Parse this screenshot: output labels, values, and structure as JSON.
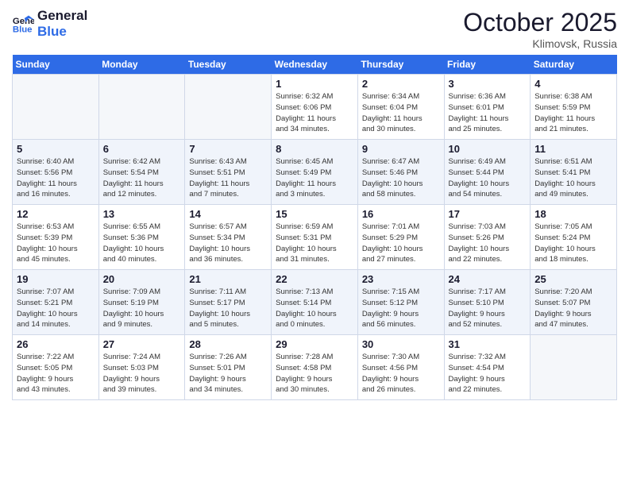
{
  "logo": {
    "line1": "General",
    "line2": "Blue"
  },
  "title": "October 2025",
  "location": "Klimovsk, Russia",
  "weekdays": [
    "Sunday",
    "Monday",
    "Tuesday",
    "Wednesday",
    "Thursday",
    "Friday",
    "Saturday"
  ],
  "weeks": [
    [
      {
        "day": "",
        "info": ""
      },
      {
        "day": "",
        "info": ""
      },
      {
        "day": "",
        "info": ""
      },
      {
        "day": "1",
        "info": "Sunrise: 6:32 AM\nSunset: 6:06 PM\nDaylight: 11 hours\nand 34 minutes."
      },
      {
        "day": "2",
        "info": "Sunrise: 6:34 AM\nSunset: 6:04 PM\nDaylight: 11 hours\nand 30 minutes."
      },
      {
        "day": "3",
        "info": "Sunrise: 6:36 AM\nSunset: 6:01 PM\nDaylight: 11 hours\nand 25 minutes."
      },
      {
        "day": "4",
        "info": "Sunrise: 6:38 AM\nSunset: 5:59 PM\nDaylight: 11 hours\nand 21 minutes."
      }
    ],
    [
      {
        "day": "5",
        "info": "Sunrise: 6:40 AM\nSunset: 5:56 PM\nDaylight: 11 hours\nand 16 minutes."
      },
      {
        "day": "6",
        "info": "Sunrise: 6:42 AM\nSunset: 5:54 PM\nDaylight: 11 hours\nand 12 minutes."
      },
      {
        "day": "7",
        "info": "Sunrise: 6:43 AM\nSunset: 5:51 PM\nDaylight: 11 hours\nand 7 minutes."
      },
      {
        "day": "8",
        "info": "Sunrise: 6:45 AM\nSunset: 5:49 PM\nDaylight: 11 hours\nand 3 minutes."
      },
      {
        "day": "9",
        "info": "Sunrise: 6:47 AM\nSunset: 5:46 PM\nDaylight: 10 hours\nand 58 minutes."
      },
      {
        "day": "10",
        "info": "Sunrise: 6:49 AM\nSunset: 5:44 PM\nDaylight: 10 hours\nand 54 minutes."
      },
      {
        "day": "11",
        "info": "Sunrise: 6:51 AM\nSunset: 5:41 PM\nDaylight: 10 hours\nand 49 minutes."
      }
    ],
    [
      {
        "day": "12",
        "info": "Sunrise: 6:53 AM\nSunset: 5:39 PM\nDaylight: 10 hours\nand 45 minutes."
      },
      {
        "day": "13",
        "info": "Sunrise: 6:55 AM\nSunset: 5:36 PM\nDaylight: 10 hours\nand 40 minutes."
      },
      {
        "day": "14",
        "info": "Sunrise: 6:57 AM\nSunset: 5:34 PM\nDaylight: 10 hours\nand 36 minutes."
      },
      {
        "day": "15",
        "info": "Sunrise: 6:59 AM\nSunset: 5:31 PM\nDaylight: 10 hours\nand 31 minutes."
      },
      {
        "day": "16",
        "info": "Sunrise: 7:01 AM\nSunset: 5:29 PM\nDaylight: 10 hours\nand 27 minutes."
      },
      {
        "day": "17",
        "info": "Sunrise: 7:03 AM\nSunset: 5:26 PM\nDaylight: 10 hours\nand 22 minutes."
      },
      {
        "day": "18",
        "info": "Sunrise: 7:05 AM\nSunset: 5:24 PM\nDaylight: 10 hours\nand 18 minutes."
      }
    ],
    [
      {
        "day": "19",
        "info": "Sunrise: 7:07 AM\nSunset: 5:21 PM\nDaylight: 10 hours\nand 14 minutes."
      },
      {
        "day": "20",
        "info": "Sunrise: 7:09 AM\nSunset: 5:19 PM\nDaylight: 10 hours\nand 9 minutes."
      },
      {
        "day": "21",
        "info": "Sunrise: 7:11 AM\nSunset: 5:17 PM\nDaylight: 10 hours\nand 5 minutes."
      },
      {
        "day": "22",
        "info": "Sunrise: 7:13 AM\nSunset: 5:14 PM\nDaylight: 10 hours\nand 0 minutes."
      },
      {
        "day": "23",
        "info": "Sunrise: 7:15 AM\nSunset: 5:12 PM\nDaylight: 9 hours\nand 56 minutes."
      },
      {
        "day": "24",
        "info": "Sunrise: 7:17 AM\nSunset: 5:10 PM\nDaylight: 9 hours\nand 52 minutes."
      },
      {
        "day": "25",
        "info": "Sunrise: 7:20 AM\nSunset: 5:07 PM\nDaylight: 9 hours\nand 47 minutes."
      }
    ],
    [
      {
        "day": "26",
        "info": "Sunrise: 7:22 AM\nSunset: 5:05 PM\nDaylight: 9 hours\nand 43 minutes."
      },
      {
        "day": "27",
        "info": "Sunrise: 7:24 AM\nSunset: 5:03 PM\nDaylight: 9 hours\nand 39 minutes."
      },
      {
        "day": "28",
        "info": "Sunrise: 7:26 AM\nSunset: 5:01 PM\nDaylight: 9 hours\nand 34 minutes."
      },
      {
        "day": "29",
        "info": "Sunrise: 7:28 AM\nSunset: 4:58 PM\nDaylight: 9 hours\nand 30 minutes."
      },
      {
        "day": "30",
        "info": "Sunrise: 7:30 AM\nSunset: 4:56 PM\nDaylight: 9 hours\nand 26 minutes."
      },
      {
        "day": "31",
        "info": "Sunrise: 7:32 AM\nSunset: 4:54 PM\nDaylight: 9 hours\nand 22 minutes."
      },
      {
        "day": "",
        "info": ""
      }
    ]
  ]
}
